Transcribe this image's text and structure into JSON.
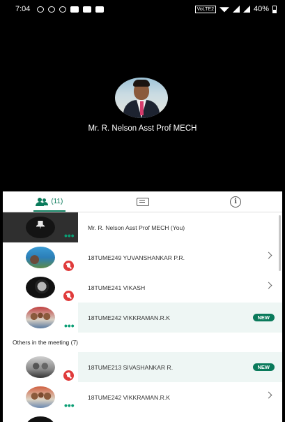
{
  "status_bar": {
    "time": "7:04",
    "volte": "VoLTE2",
    "battery": "40%"
  },
  "video": {
    "host_name": "Mr. R. Nelson Asst Prof MECH"
  },
  "tabs": {
    "participants_count": "(11)"
  },
  "participants": [
    {
      "name": "Mr. R. Nelson Asst Prof MECH (You)"
    },
    {
      "name": "18TUME249 YUVANSHANKAR P.R."
    },
    {
      "name": "18TUME241 VIKASH"
    },
    {
      "name": "18TUME242 VIKKRAMAN.R.K",
      "badge": "NEW"
    }
  ],
  "others": {
    "title": "Others in the meeting (7)",
    "items": [
      {
        "name": "18TUME213 SIVASHANKAR R.",
        "badge": "NEW"
      },
      {
        "name": "18TUME242 VIKKRAMAN.R.K"
      }
    ]
  },
  "colors": {
    "accent": "#0a7a5b",
    "mic_off": "#e03b3b",
    "highlight_row": "#eef6f4"
  }
}
